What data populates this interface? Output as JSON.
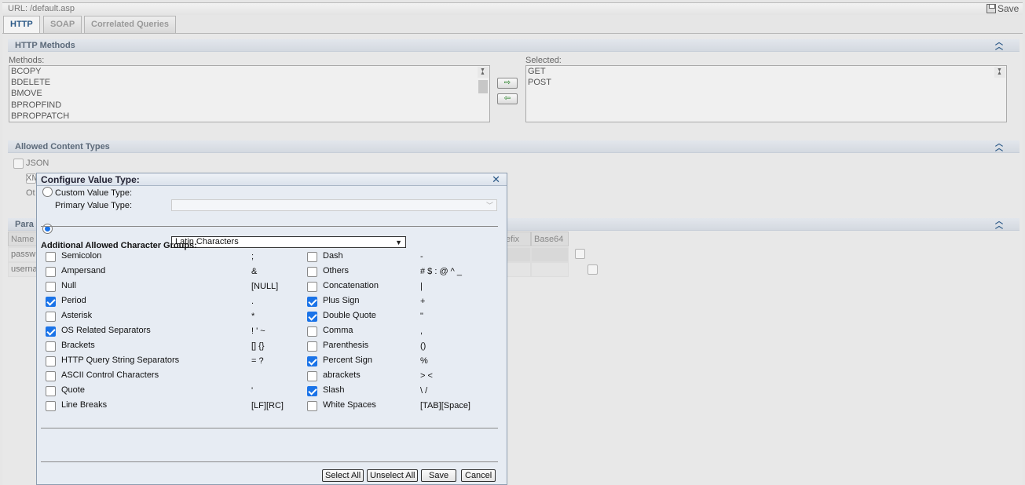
{
  "header": {
    "url_text": "URL: /default.asp",
    "save_label": "Save"
  },
  "tabs": [
    {
      "label": "HTTP",
      "active": true
    },
    {
      "label": "SOAP"
    },
    {
      "label": "Correlated Queries"
    }
  ],
  "http_methods": {
    "title": "HTTP Methods",
    "methods_label": "Methods:",
    "methods": [
      "BCOPY",
      "BDELETE",
      "BMOVE",
      "BPROPFIND",
      "BPROPPATCH"
    ],
    "selected_label": "Selected:",
    "selected": [
      "GET",
      "POST"
    ]
  },
  "content_types": {
    "title": "Allowed Content Types",
    "items": [
      {
        "label": "JSON",
        "checked": false
      },
      {
        "label": "XM",
        "checked": false
      },
      {
        "label": "Ot",
        "checked": true
      }
    ]
  },
  "parameters": {
    "title": "Para",
    "columns": {
      "name": "Name",
      "prefix": "efix",
      "base64": "Base64"
    },
    "rows": [
      "passw",
      "userna"
    ]
  },
  "dialog": {
    "title": "Configure Value Type:",
    "custom_label": "Custom Value Type:",
    "custom_value": "",
    "primary_label": "Primary Value Type:",
    "primary_value": "Latin Characters",
    "groups_title": "Additional Allowed Character Groups:",
    "groups_left": [
      {
        "name": "Semicolon",
        "chars": ";",
        "checked": false
      },
      {
        "name": "Ampersand",
        "chars": "&",
        "checked": false
      },
      {
        "name": "Null",
        "chars": "[NULL]",
        "checked": false
      },
      {
        "name": "Period",
        "chars": ".",
        "checked": true
      },
      {
        "name": "Asterisk",
        "chars": "*",
        "checked": false
      },
      {
        "name": "OS Related Separators",
        "chars": "! ' ~",
        "checked": true
      },
      {
        "name": "Brackets",
        "chars": "[] {}",
        "checked": false
      },
      {
        "name": "HTTP Query String Separators",
        "chars": "= ?",
        "checked": false
      },
      {
        "name": "ASCII Control Characters",
        "chars": "",
        "checked": false
      },
      {
        "name": "Quote",
        "chars": "'",
        "checked": false
      },
      {
        "name": "Line Breaks",
        "chars": "[LF][RC]",
        "checked": false
      }
    ],
    "groups_right": [
      {
        "name": "Dash",
        "chars": "-",
        "checked": false
      },
      {
        "name": "Others",
        "chars": "# $ : @ ^ _",
        "checked": false
      },
      {
        "name": "Concatenation",
        "chars": "|",
        "checked": false
      },
      {
        "name": "Plus Sign",
        "chars": "+",
        "checked": true
      },
      {
        "name": "Double Quote",
        "chars": "\"",
        "checked": true
      },
      {
        "name": "Comma",
        "chars": ",",
        "checked": false
      },
      {
        "name": "Parenthesis",
        "chars": "()",
        "checked": false
      },
      {
        "name": "Percent Sign",
        "chars": "%",
        "checked": true
      },
      {
        "name": "abrackets",
        "chars": "> <",
        "checked": false
      },
      {
        "name": "Slash",
        "chars": "\\ /",
        "checked": true
      },
      {
        "name": "White Spaces",
        "chars": "[TAB][Space]",
        "checked": false
      }
    ],
    "buttons": {
      "select_all": "Select All",
      "unselect_all": "Unselect All",
      "save": "Save",
      "cancel": "Cancel"
    }
  },
  "colors": {
    "accent": "#1a73e8",
    "tab_active_text": "#2d5a88",
    "section_title": "#5c6a7a"
  }
}
